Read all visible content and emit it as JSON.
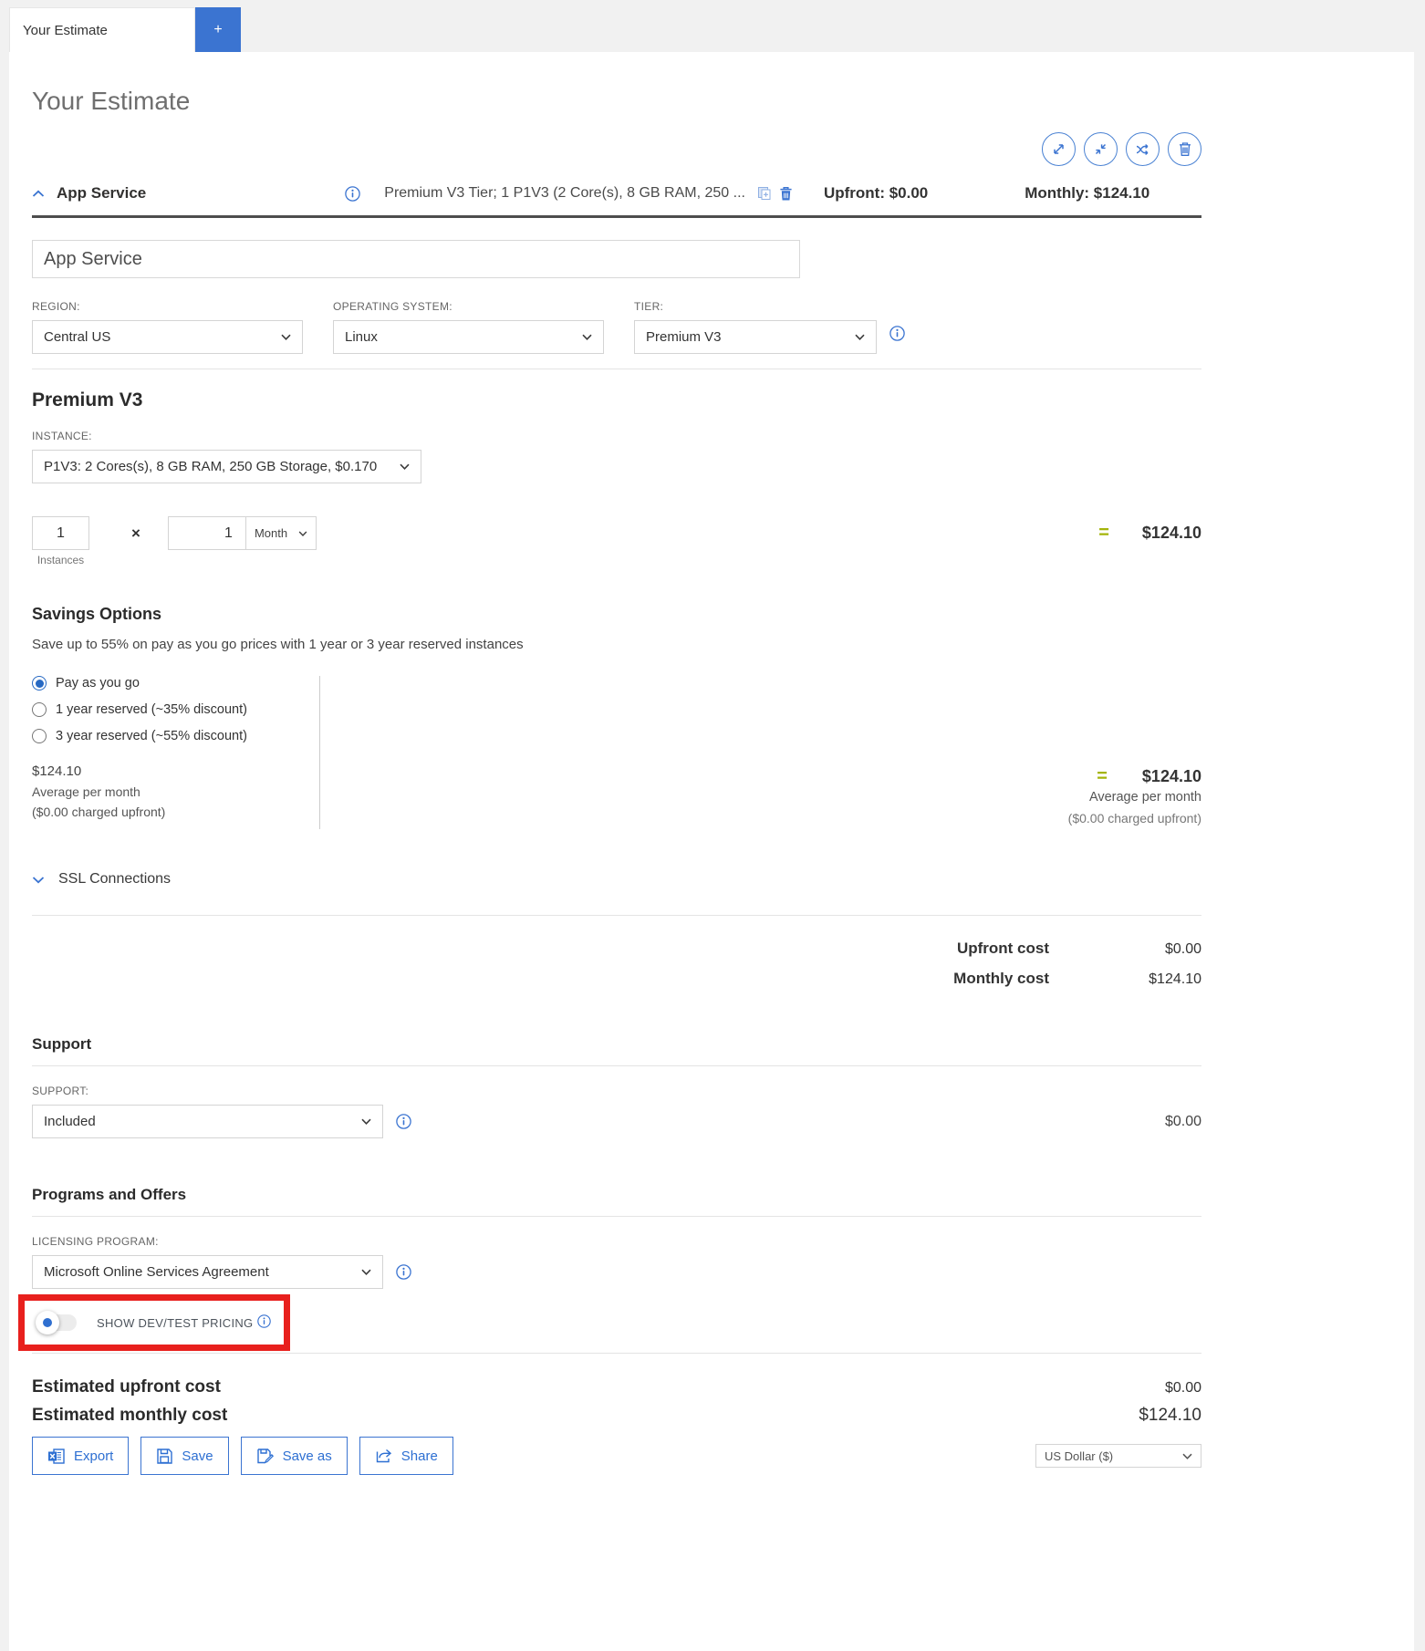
{
  "colors": {
    "accent_blue": "#3b74d1",
    "equals_green": "#a4b40a",
    "highlight_red": "#e8201d"
  },
  "tabs": {
    "estimate": "Your Estimate",
    "add": "+"
  },
  "page": {
    "title": "Your Estimate"
  },
  "service": {
    "name": "App Service",
    "summary": "Premium V3 Tier; 1 P1V3 (2 Core(s), 8 GB RAM, 250 ...",
    "upfront": "Upfront: $0.00",
    "monthly": "Monthly: $124.10",
    "name_input_value": "App Service",
    "region_label": "REGION:",
    "region_value": "Central US",
    "os_label": "OPERATING SYSTEM:",
    "os_value": "Linux",
    "tier_label": "TIER:",
    "tier_value": "Premium V3"
  },
  "tier": {
    "title": "Premium V3",
    "instance_label": "INSTANCE:",
    "instance_value": "P1V3: 2 Cores(s), 8 GB RAM, 250 GB Storage, $0.170",
    "instances_value": "1",
    "instances_caption": "Instances",
    "multiply": "×",
    "duration_value": "1",
    "duration_unit": "Month",
    "equals": "=",
    "subtotal": "$124.10"
  },
  "savings": {
    "title": "Savings Options",
    "subtitle": "Save up to 55% on pay as you go prices with 1 year or 3 year reserved instances",
    "options": [
      {
        "label": "Pay as you go",
        "selected": true
      },
      {
        "label": "1 year reserved (~35% discount)",
        "selected": false
      },
      {
        "label": "3 year reserved (~55% discount)",
        "selected": false
      }
    ],
    "left": {
      "price": "$124.10",
      "line1": "Average per month",
      "line2": "($0.00 charged upfront)"
    },
    "right": {
      "equals": "=",
      "price": "$124.10",
      "line1": "Average per month",
      "line2": "($0.00 charged upfront)"
    }
  },
  "ssl": {
    "label": "SSL Connections"
  },
  "totals": {
    "upfront_label": "Upfront cost",
    "upfront_value": "$0.00",
    "monthly_label": "Monthly cost",
    "monthly_value": "$124.10"
  },
  "support": {
    "title": "Support",
    "label": "SUPPORT:",
    "value": "Included",
    "price": "$0.00"
  },
  "programs": {
    "title": "Programs and Offers",
    "label": "LICENSING PROGRAM:",
    "value": "Microsoft Online Services Agreement",
    "dev_test_label": "SHOW DEV/TEST PRICING"
  },
  "footer": {
    "upfront_label": "Estimated upfront cost",
    "upfront_value": "$0.00",
    "monthly_label": "Estimated monthly cost",
    "monthly_value": "$124.10",
    "buttons": [
      {
        "label": "Export"
      },
      {
        "label": "Save"
      },
      {
        "label": "Save as"
      },
      {
        "label": "Share"
      }
    ],
    "currency": "US Dollar ($)"
  }
}
